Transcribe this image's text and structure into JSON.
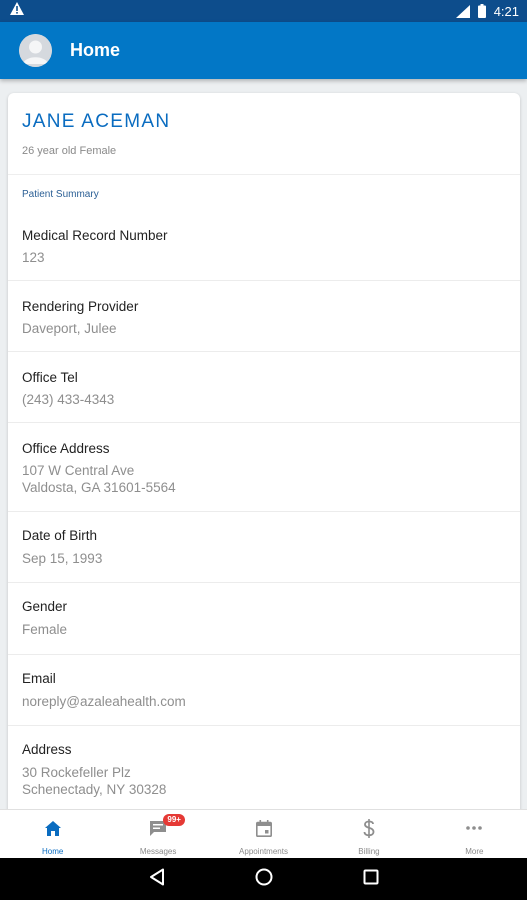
{
  "status_bar": {
    "time": "4:21",
    "icons": [
      "warning-icon",
      "wifi-icon",
      "battery-icon"
    ]
  },
  "app_bar": {
    "title": "Home",
    "color": "#0277c6"
  },
  "patient": {
    "name": "JANE ACEMAN",
    "subtitle": "26 year old Female",
    "section_title": "Patient Summary"
  },
  "fields": [
    {
      "label": "Medical Record Number",
      "value": "123"
    },
    {
      "label": "Rendering Provider",
      "value": "Daveport, Julee"
    },
    {
      "label": "Office Tel",
      "value": "(243) 433-4343"
    },
    {
      "label": "Office Address",
      "value_line1": "107 W Central Ave",
      "value_line2": "Valdosta, GA 31601-5564"
    },
    {
      "label": "Date of Birth",
      "value": "Sep 15, 1993"
    },
    {
      "label": "Gender",
      "value": "Female"
    },
    {
      "label": "Email",
      "value": "noreply@azaleahealth.com"
    },
    {
      "label": "Address",
      "value_line1": "30 Rockefeller Plz",
      "value_line2": "Schenectady, NY 30328"
    }
  ],
  "bottom_nav": {
    "items": [
      {
        "label": "Home",
        "icon": "home-icon",
        "active": true
      },
      {
        "label": "Messages",
        "icon": "message-icon",
        "badge": "99+"
      },
      {
        "label": "Appointments",
        "icon": "calendar-icon"
      },
      {
        "label": "Billing",
        "icon": "dollar-icon"
      },
      {
        "label": "More",
        "icon": "more-icon"
      }
    ]
  },
  "android_nav": {
    "icons": [
      "back-icon",
      "home-circle-icon",
      "recents-icon"
    ]
  }
}
